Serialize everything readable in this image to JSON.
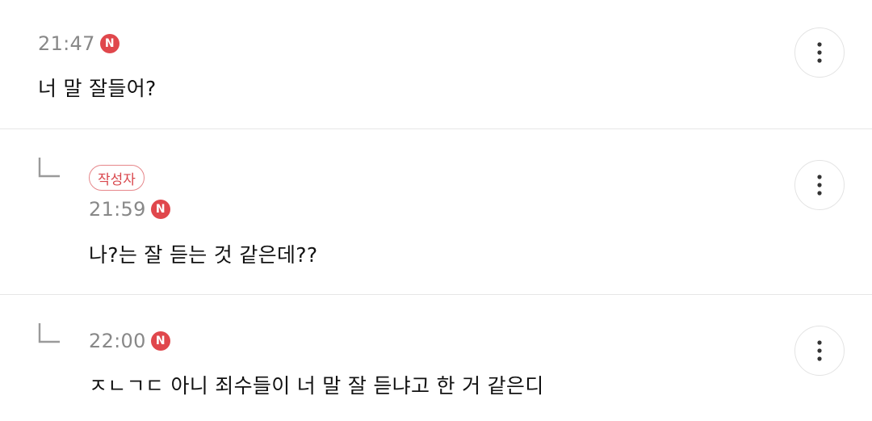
{
  "comments": [
    {
      "time": "21:47",
      "new_badge": "N",
      "text": "너 말 잘들어?",
      "is_reply": false,
      "more_icon": "more-vertical-icon"
    },
    {
      "author_badge": "작성자",
      "time": "21:59",
      "new_badge": "N",
      "text": "나?는 잘 듣는 것 같은데??",
      "is_reply": true,
      "reply_icon": "reply-arrow-icon",
      "more_icon": "more-vertical-icon"
    },
    {
      "time": "22:00",
      "new_badge": "N",
      "text": "ㅈㄴㄱㄷ 아니 죄수들이 너 말 잘 듣냐고 한 거 같은디",
      "is_reply": true,
      "reply_icon": "reply-arrow-icon",
      "more_icon": "more-vertical-icon"
    }
  ],
  "colors": {
    "new_badge": "#e0474c",
    "author_badge": "#d9474d",
    "timestamp": "#888888",
    "divider": "#e6e6e6"
  }
}
